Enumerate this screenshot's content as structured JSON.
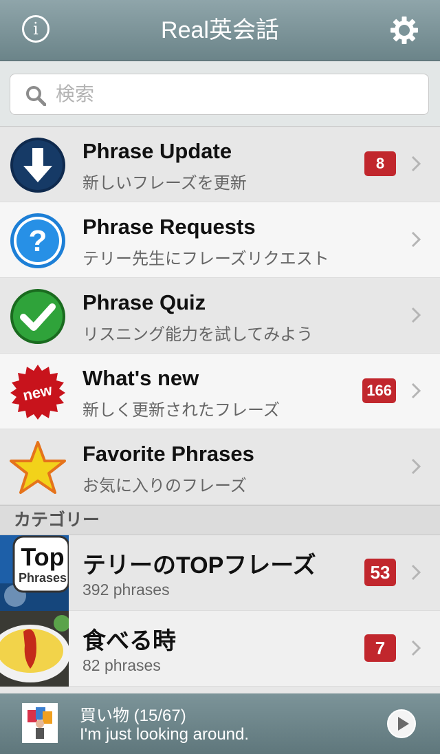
{
  "nav": {
    "title": "Real英会話",
    "info_label": "i"
  },
  "search": {
    "placeholder": "検索"
  },
  "menu": [
    {
      "title": "Phrase Update",
      "subtitle": "新しいフレーズを更新",
      "badge": "8",
      "icon": "download-icon"
    },
    {
      "title": "Phrase Requests",
      "subtitle": "テリー先生にフレーズリクエスト",
      "badge": "",
      "icon": "question-icon"
    },
    {
      "title": "Phrase Quiz",
      "subtitle": "リスニング能力を試してみよう",
      "badge": "",
      "icon": "checkmark-icon"
    },
    {
      "title": "What's new",
      "subtitle": "新しく更新されたフレーズ",
      "badge": "166",
      "icon": "new-seal-icon",
      "icon_text": "new"
    },
    {
      "title": "Favorite Phrases",
      "subtitle": "お気に入りのフレーズ",
      "badge": "",
      "icon": "star-icon"
    }
  ],
  "section_header": "カテゴリー",
  "categories": [
    {
      "title": "テリーのTOPフレーズ",
      "subtitle": "392 phrases",
      "badge": "53",
      "thumb_top": "Top",
      "thumb_bottom": "Phrases"
    },
    {
      "title": "食べる時",
      "subtitle": "82 phrases",
      "badge": "7"
    }
  ],
  "player": {
    "line1": "買い物 (15/67)",
    "line2": "I'm just looking around."
  },
  "colors": {
    "badge": "#c1272d",
    "navbar": "#7c9499"
  }
}
